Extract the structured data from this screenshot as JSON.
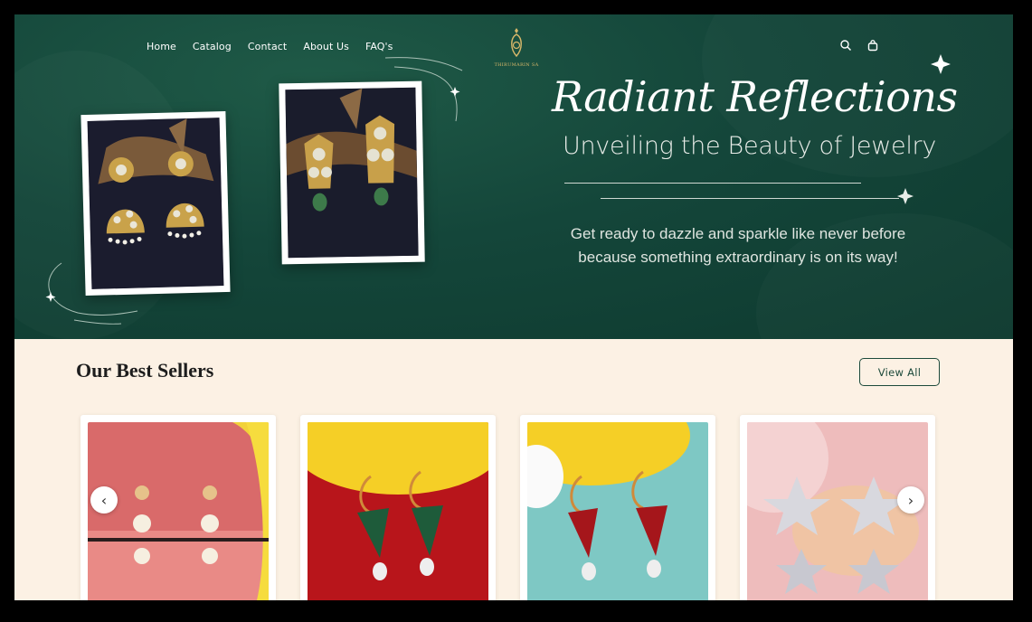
{
  "nav": {
    "items": [
      {
        "label": "Home"
      },
      {
        "label": "Catalog"
      },
      {
        "label": "Contact"
      },
      {
        "label": "About Us"
      },
      {
        "label": "FAQ's"
      }
    ]
  },
  "logo": {
    "text": "THIRUMARIN SA"
  },
  "header_icons": [
    "search-icon",
    "cart-icon"
  ],
  "hero": {
    "headline": "Radiant Reflections",
    "subheadline": "Unveiling the Beauty of Jewelry",
    "tagline": "Get ready to dazzle and sparkle like never before because something extraordinary is on its way!"
  },
  "best_sellers": {
    "title": "Our Best Sellers",
    "view_all_label": "View All",
    "products": [
      {
        "image": "pearl-flower-earrings"
      },
      {
        "image": "green-enamel-leaf-earrings"
      },
      {
        "image": "red-enamel-leaf-earrings"
      },
      {
        "image": "silver-star-earrings"
      }
    ],
    "prev_label": "‹",
    "next_label": "›"
  },
  "colors": {
    "hero_bg": "#14463a",
    "section_bg": "#fcf1e4",
    "accent": "#1d4a3b",
    "gold": "#d8b86a"
  }
}
